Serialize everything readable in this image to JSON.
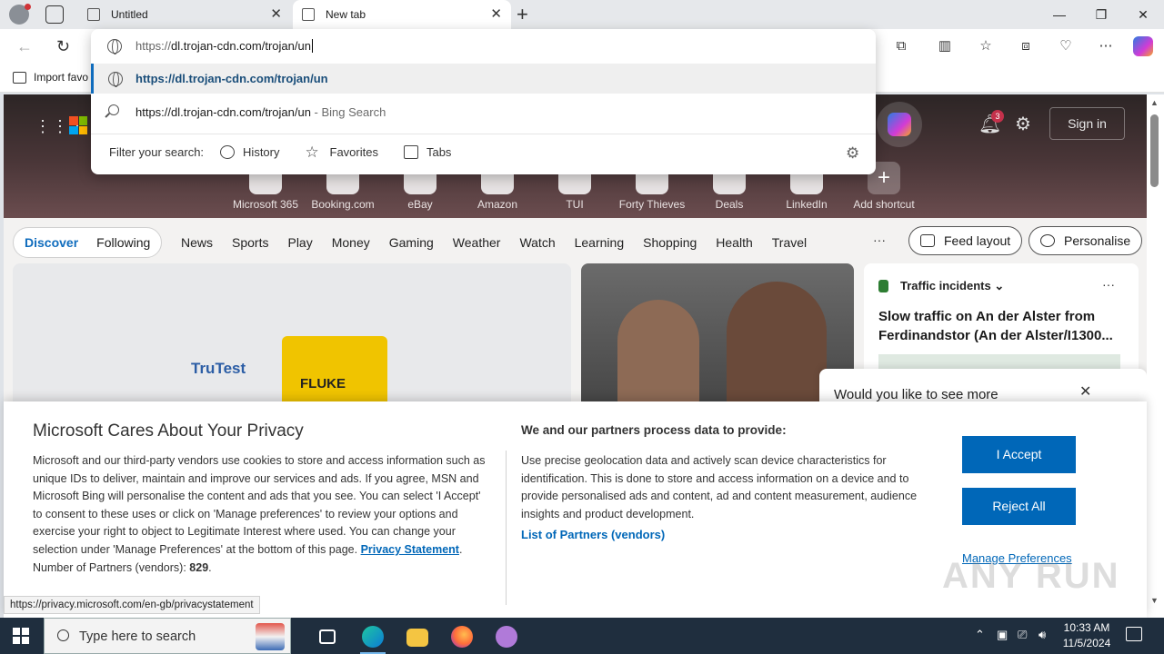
{
  "browser": {
    "tabs": [
      {
        "title": "Untitled",
        "active": false
      },
      {
        "title": "New tab",
        "active": true
      }
    ],
    "favorites_bar": {
      "import_label": "Import favo"
    },
    "address_bar": {
      "value_protocol": "https://",
      "value_rest": "dl.trojan-cdn.com/trojan/un"
    },
    "suggestions": [
      {
        "type": "url",
        "text": "https://dl.trojan-cdn.com/trojan/un"
      },
      {
        "type": "search",
        "text": "https://dl.trojan-cdn.com/trojan/un",
        "suffix": " - Bing Search"
      }
    ],
    "filter": {
      "label": "Filter your search:",
      "items": [
        "History",
        "Favorites",
        "Tabs"
      ]
    }
  },
  "msn": {
    "notifications_count": "3",
    "signin_label": "Sign in",
    "shortcuts": [
      "Microsoft 365",
      "Booking.com",
      "eBay",
      "Amazon",
      "TUI",
      "Forty Thieves",
      "Deals",
      "LinkedIn",
      "Add shortcut"
    ],
    "feed_tabs": {
      "discover": "Discover",
      "following": "Following"
    },
    "nav_links": [
      "News",
      "Sports",
      "Play",
      "Money",
      "Gaming",
      "Weather",
      "Watch",
      "Learning",
      "Shopping",
      "Health",
      "Travel"
    ],
    "feed_layout_label": "Feed layout",
    "personalise_label": "Personalise",
    "card1": {
      "brand": "TruTest",
      "product": "FLUKE"
    },
    "card3": {
      "header": "Traffic incidents",
      "title": "Slow traffic on An der Alster from Ferdinandstor (An der Alster/I1300..."
    },
    "popup_text": "Would you like to see more"
  },
  "privacy": {
    "title": "Microsoft Cares About Your Privacy",
    "body": "Microsoft and our third-party vendors use cookies to store and access information such as unique IDs to deliver, maintain and improve our services and ads. If you agree, MSN and Microsoft Bing will personalise the content and ads that you see. You can select 'I Accept' to consent to these uses or click on 'Manage preferences' to review your options and exercise your right to object to Legitimate Interest where used.  You can change your selection under 'Manage Preferences' at the bottom of this page.",
    "privacy_link": "Privacy Statement",
    "partners_label": "Number of Partners (vendors):",
    "partners_count": "829",
    "subheading": "We and our partners process data to provide:",
    "body2": "Use precise geolocation data and actively scan device characteristics for identification. This is done to store and access information on a device and to provide personalised ads and content, ad and content measurement, audience insights and product development.",
    "partners_link": "List of Partners (vendors)",
    "accept_label": "I Accept",
    "reject_label": "Reject All",
    "manage_label": "Manage Preferences"
  },
  "status_url": "https://privacy.microsoft.com/en-gb/privacystatement",
  "watermark": "ANY RUN",
  "taskbar": {
    "search_placeholder": "Type here to search",
    "time": "10:33 AM",
    "date": "11/5/2024"
  },
  "colors": {
    "accent": "#0067b8",
    "edge_blue": "#0f6cbd",
    "taskbar": "#1f2e3e"
  }
}
